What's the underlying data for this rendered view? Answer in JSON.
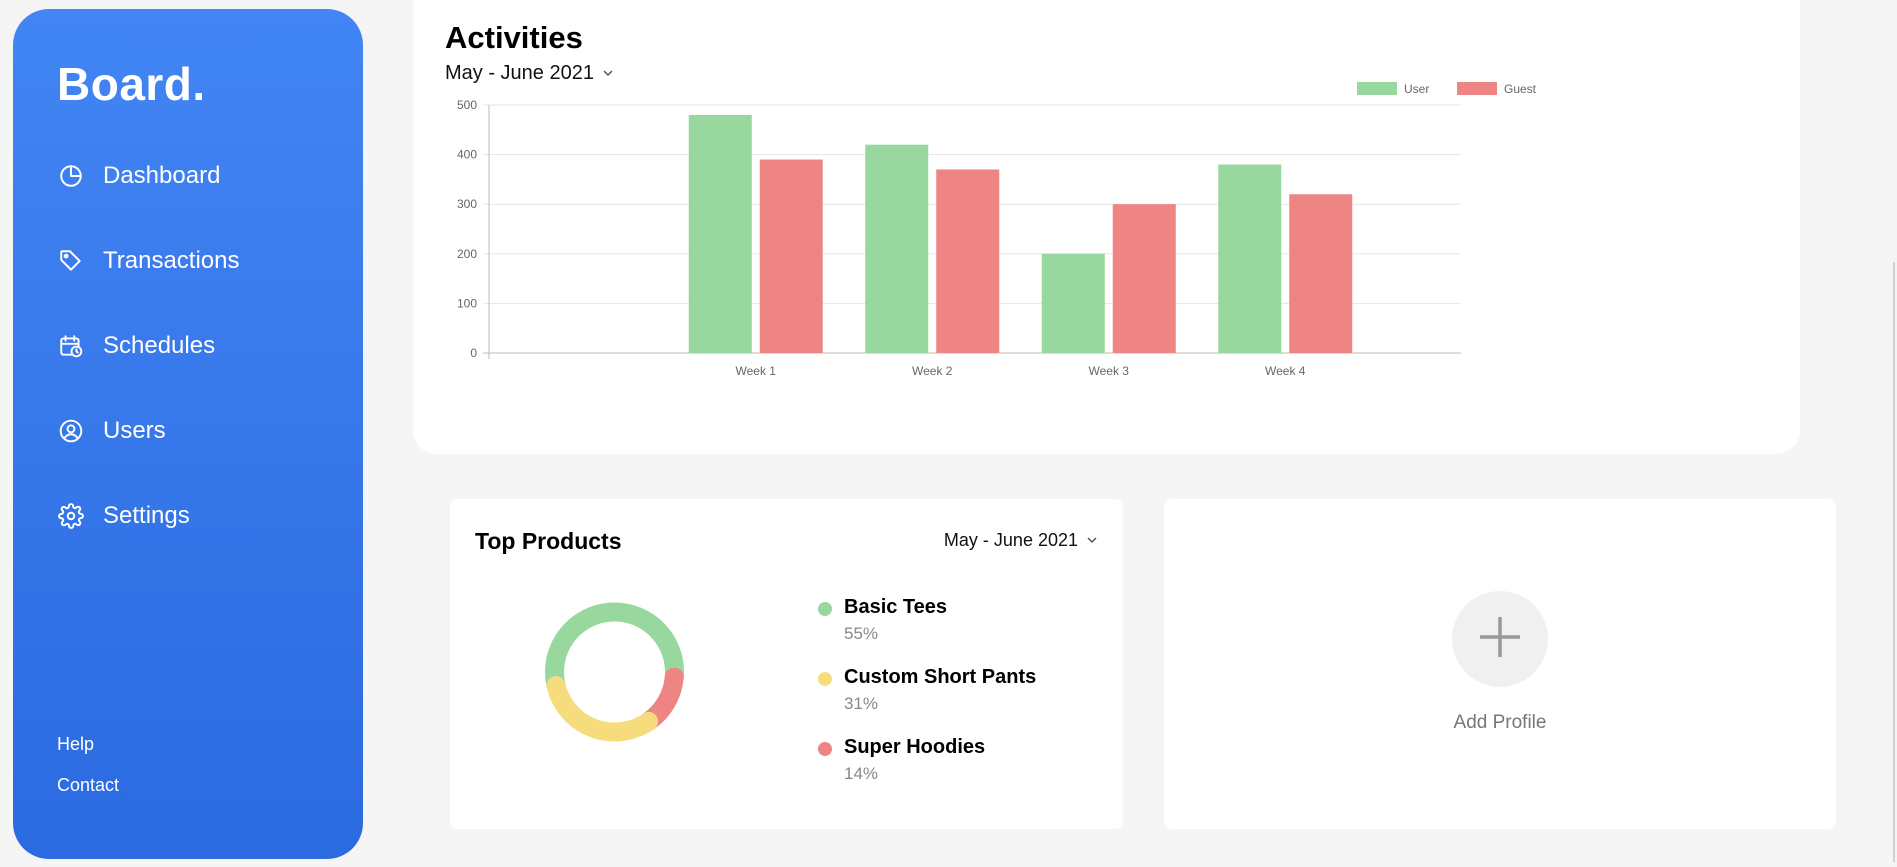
{
  "sidebar": {
    "brand": "Board.",
    "items": [
      {
        "label": "Dashboard",
        "icon": "pie-chart-icon"
      },
      {
        "label": "Transactions",
        "icon": "tag-icon"
      },
      {
        "label": "Schedules",
        "icon": "calendar-clock-icon"
      },
      {
        "label": "Users",
        "icon": "user-circle-icon"
      },
      {
        "label": "Settings",
        "icon": "gear-icon"
      }
    ],
    "footer": {
      "help": "Help",
      "contact": "Contact"
    }
  },
  "activities": {
    "title": "Activities",
    "range": "May - June 2021"
  },
  "top_products": {
    "title": "Top Products",
    "range": "May - June 2021",
    "items": [
      {
        "name": "Basic Tees",
        "pct": "55%",
        "color": "#98d89e"
      },
      {
        "name": "Custom Short Pants",
        "pct": "31%",
        "color": "#f6dc7d"
      },
      {
        "name": "Super Hoodies",
        "pct": "14%",
        "color": "#ee8484"
      }
    ]
  },
  "add_profile": {
    "label": "Add Profile"
  },
  "colors": {
    "accent": "#4285f4",
    "user": "#98d89e",
    "guest": "#ee8484"
  },
  "chart_data": [
    {
      "type": "bar",
      "categories": [
        "Week 1",
        "Week 2",
        "Week 3",
        "Week 4"
      ],
      "series": [
        {
          "name": "User",
          "values": [
            480,
            420,
            200,
            380
          ],
          "color": "#98d89e"
        },
        {
          "name": "Guest",
          "values": [
            390,
            370,
            300,
            320
          ],
          "color": "#ee8484"
        }
      ],
      "ylim": [
        0,
        500
      ],
      "yticks": [
        0,
        100,
        200,
        300,
        400,
        500
      ],
      "grid": true,
      "legend": "top-right"
    },
    {
      "type": "pie",
      "categories": [
        "Basic Tees",
        "Custom Short Pants",
        "Super Hoodies"
      ],
      "values": [
        55,
        31,
        14
      ],
      "colors": [
        "#98d89e",
        "#f6dc7d",
        "#ee8484"
      ]
    }
  ]
}
